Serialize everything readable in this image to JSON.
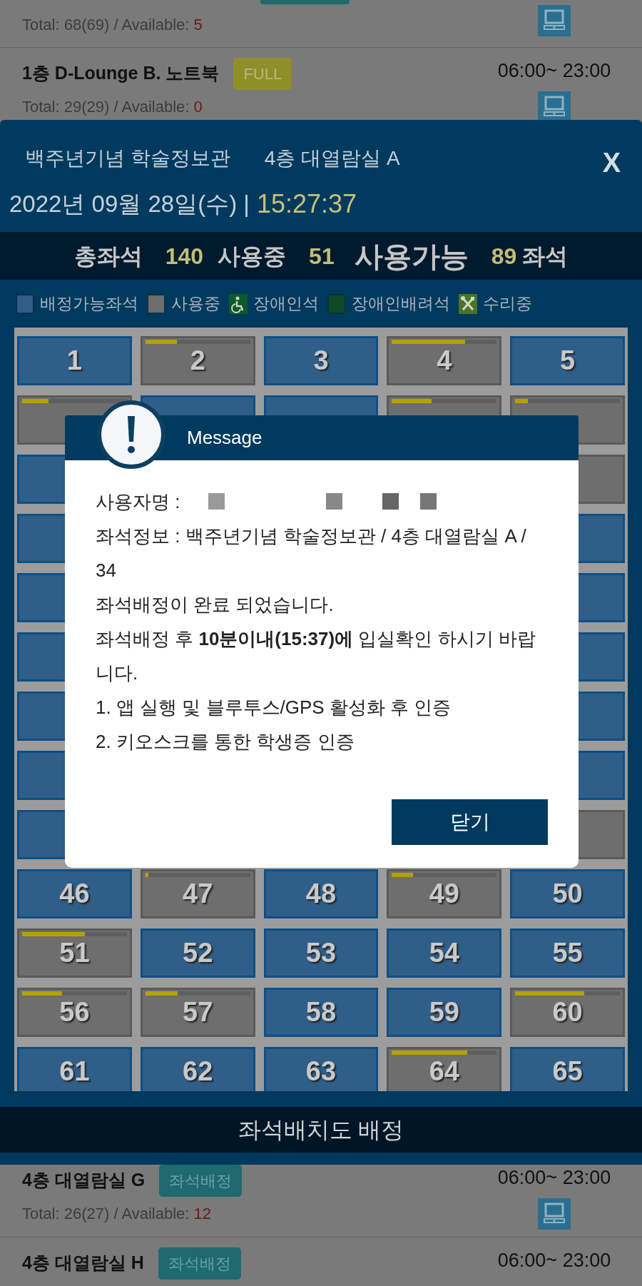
{
  "list_top": [
    {
      "kind": "partial",
      "total": "Total: 68(69) / Available: ",
      "available": "5"
    },
    {
      "kind": "full",
      "title": "1층 D-Lounge B. 노트북",
      "badge": "FULL",
      "hours": "06:00~ 23:00",
      "total": "Total: 29(29) / Available: ",
      "available": "0"
    }
  ],
  "list_bottom": [
    {
      "kind": "open",
      "title": "4층 대열람실 G",
      "badge": "좌석배정",
      "hours": "06:00~ 23:00",
      "total": "Total: 26(27) / Available: ",
      "available": "12"
    },
    {
      "kind": "open",
      "title": "4층 대열람실 H",
      "badge": "좌석배정",
      "hours": "06:00~ 23:00"
    }
  ],
  "seat_panel": {
    "building": "백주년기념 학술정보관",
    "room": "4층 대열람실 A",
    "close": "X",
    "date": "2022년 09월 28일(수) |",
    "time": "15:27:37",
    "stats": [
      {
        "kind": "normal",
        "label": "총좌석",
        "value": "140"
      },
      {
        "kind": "normal",
        "label": "사용중",
        "value": "51"
      },
      {
        "kind": "main",
        "label": "사용가능",
        "value": "89"
      }
    ],
    "stats_unit": "좌석",
    "legend": [
      {
        "kind": "swatch",
        "color": "#2f5e88",
        "label": "배정가능좌석"
      },
      {
        "kind": "swatch",
        "color": "#6e6e6e",
        "label": "사용중"
      },
      {
        "kind": "wheelchair",
        "color": "#0e5a2a",
        "label": "장애인석"
      },
      {
        "kind": "swatch",
        "color": "#0b4a22",
        "label": "장애인배려석"
      },
      {
        "kind": "repair",
        "color": "#4a7426",
        "label": "수리중"
      }
    ],
    "seat_rows": [
      [
        {
          "number": "1",
          "occupied": false
        },
        {
          "number": "2",
          "occupied": true,
          "level": 0.3
        },
        {
          "number": "3",
          "occupied": false
        },
        {
          "number": "4",
          "occupied": true,
          "level": 0.7
        },
        {
          "number": "5",
          "occupied": false
        }
      ],
      [
        {
          "occupied": true,
          "level": 0.25
        },
        {
          "occupied": false
        },
        {
          "occupied": false
        },
        {
          "occupied": true,
          "level": 0.38
        },
        {
          "occupied": true,
          "level": 0.12
        }
      ],
      [
        {
          "occupied": false
        },
        null,
        null,
        null,
        {
          "occupied": true
        }
      ],
      [
        {
          "occupied": false
        },
        null,
        null,
        null,
        {
          "occupied": false
        }
      ],
      [
        {
          "occupied": false
        },
        null,
        null,
        null,
        {
          "occupied": false
        }
      ],
      [
        {
          "occupied": false
        },
        null,
        null,
        null,
        {
          "occupied": false
        }
      ],
      [
        {
          "occupied": false
        },
        null,
        null,
        null,
        {
          "occupied": false
        }
      ],
      [
        {
          "occupied": false
        },
        null,
        null,
        null,
        {
          "occupied": false
        }
      ],
      [
        {
          "occupied": false
        },
        null,
        null,
        null,
        {
          "occupied": true
        }
      ],
      [
        {
          "number": "46",
          "occupied": false
        },
        {
          "number": "47",
          "occupied": true,
          "level": 0.03
        },
        {
          "number": "48",
          "occupied": false
        },
        {
          "number": "49",
          "occupied": true,
          "level": 0.2
        },
        {
          "number": "50",
          "occupied": false
        }
      ],
      [
        {
          "number": "51",
          "occupied": true,
          "level": 0.6
        },
        {
          "number": "52",
          "occupied": false
        },
        {
          "number": "53",
          "occupied": false
        },
        {
          "number": "54",
          "occupied": false
        },
        {
          "number": "55",
          "occupied": false
        }
      ],
      [
        {
          "number": "56",
          "occupied": true,
          "level": 0.38
        },
        {
          "number": "57",
          "occupied": true,
          "level": 0.31
        },
        {
          "number": "58",
          "occupied": false
        },
        {
          "number": "59",
          "occupied": false
        },
        {
          "number": "60",
          "occupied": true,
          "level": 0.66
        }
      ],
      [
        {
          "number": "61",
          "occupied": false
        },
        {
          "number": "62",
          "occupied": false
        },
        {
          "number": "63",
          "occupied": false
        },
        {
          "number": "64",
          "occupied": true,
          "level": 0.72
        },
        {
          "number": "65",
          "occupied": false
        }
      ]
    ],
    "assign_button": "좌석배치도 배정"
  },
  "dialog": {
    "title": "Message",
    "lines": [
      {
        "text": "사용자명 :",
        "redacted": true
      },
      {
        "text": "좌석정보 : 백주년기념 학술정보관 / 4층 대열람실 A / 34"
      },
      {
        "text": "좌석배정이 완료 되었습니다."
      },
      {
        "text": "좌석배정 후 **10분이내(15:37)에** 입실확인 하시기 바랍니다."
      },
      {
        "text": "1. 앱 실행 및 블루투스/GPS 활성화 후 인증"
      },
      {
        "text": "2. 키오스크를 통한 학생증 인증"
      }
    ],
    "button": "닫기"
  }
}
